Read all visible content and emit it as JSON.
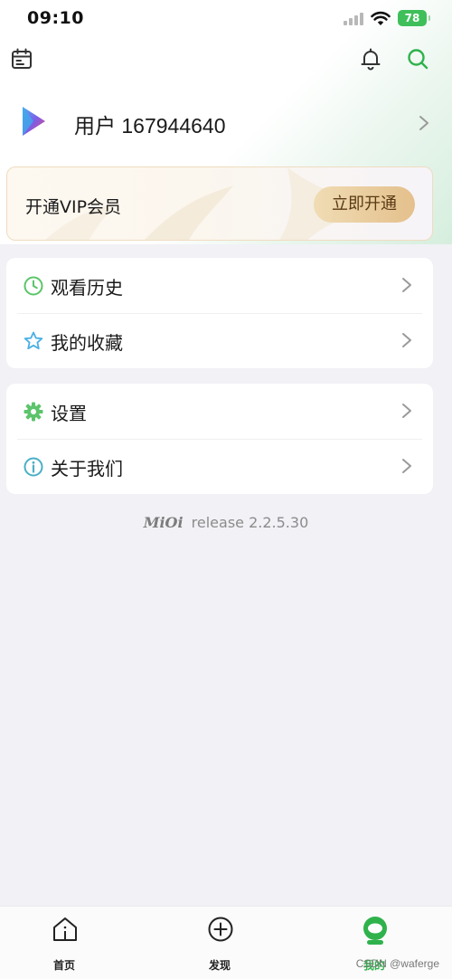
{
  "status_bar": {
    "time": "09:10",
    "battery": "78"
  },
  "header": {
    "left_icon": "calendar-icon",
    "right_icons": [
      "bell-icon",
      "search-icon"
    ],
    "accent_color": "#2fb24c"
  },
  "profile": {
    "username": "用户 167944640"
  },
  "vip": {
    "title": "开通VIP会员",
    "button": "立即开通"
  },
  "menu_groups": [
    {
      "items": [
        {
          "icon": "clock-icon",
          "label": "观看历史"
        },
        {
          "icon": "star-icon",
          "label": "我的收藏"
        }
      ]
    },
    {
      "items": [
        {
          "icon": "gear-icon",
          "label": "设置"
        },
        {
          "icon": "info-icon",
          "label": "关于我们"
        }
      ]
    }
  ],
  "release": {
    "logo": "MiOi",
    "text": "release 2.2.5.30"
  },
  "tabbar": {
    "tabs": [
      {
        "icon": "home-icon",
        "label": "首页",
        "active": false
      },
      {
        "icon": "plus-circle-icon",
        "label": "发现",
        "active": false
      },
      {
        "icon": "profile-icon",
        "label": "我的",
        "active": true
      }
    ]
  },
  "watermark": "CSDN @waferge"
}
